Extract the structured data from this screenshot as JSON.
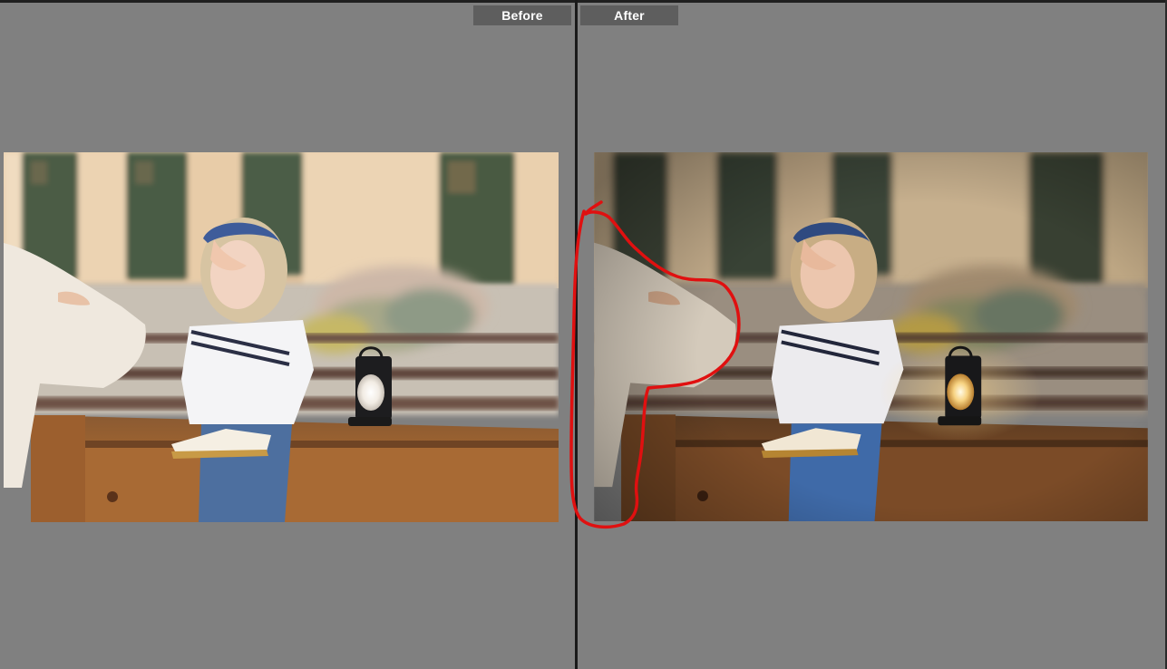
{
  "compare_view": {
    "before": {
      "label": "Before"
    },
    "after": {
      "label": "After"
    }
  },
  "colors": {
    "background": "#808080",
    "label_bg": "#5e5e5e",
    "divider": "#1a1a1a",
    "annotation_stroke": "#e01010"
  }
}
